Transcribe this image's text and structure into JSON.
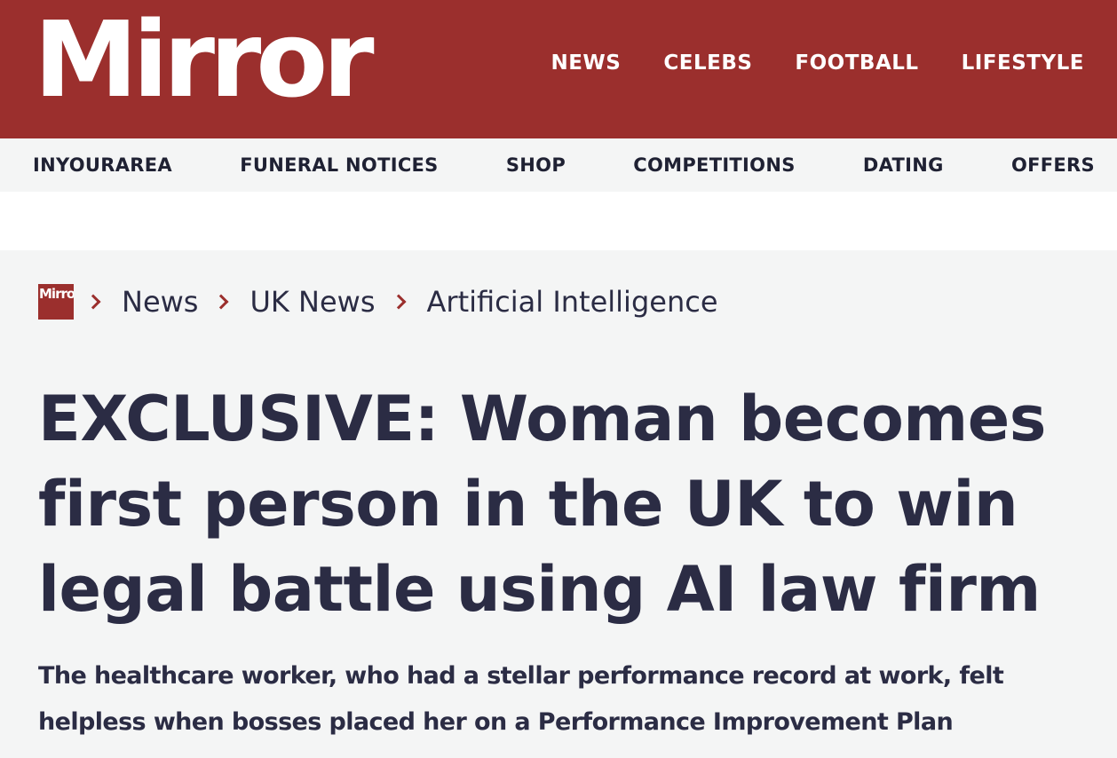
{
  "masthead": {
    "logo_text": "Mirror",
    "brand_color": "#9b2f2d",
    "nav": [
      {
        "label": "NEWS"
      },
      {
        "label": "CELEBS"
      },
      {
        "label": "FOOTBALL"
      },
      {
        "label": "LIFESTYLE"
      }
    ]
  },
  "secondary_nav": [
    {
      "label": "INYOURAREA"
    },
    {
      "label": "FUNERAL NOTICES"
    },
    {
      "label": "SHOP"
    },
    {
      "label": "COMPETITIONS"
    },
    {
      "label": "DATING"
    },
    {
      "label": "OFFERS"
    }
  ],
  "breadcrumb": {
    "logo_text": "Mirror",
    "items": [
      {
        "label": "News"
      },
      {
        "label": "UK News"
      },
      {
        "label": "Artificial Intelligence"
      }
    ],
    "separator_icon": "chevron-right-icon"
  },
  "article": {
    "headline": "EXCLUSIVE: Woman becomes first person in the UK to win legal battle using AI law firm",
    "standfirst": "The healthcare worker, who had a stellar performance record at work, felt helpless when bosses placed her on a Performance Improvement Plan"
  }
}
